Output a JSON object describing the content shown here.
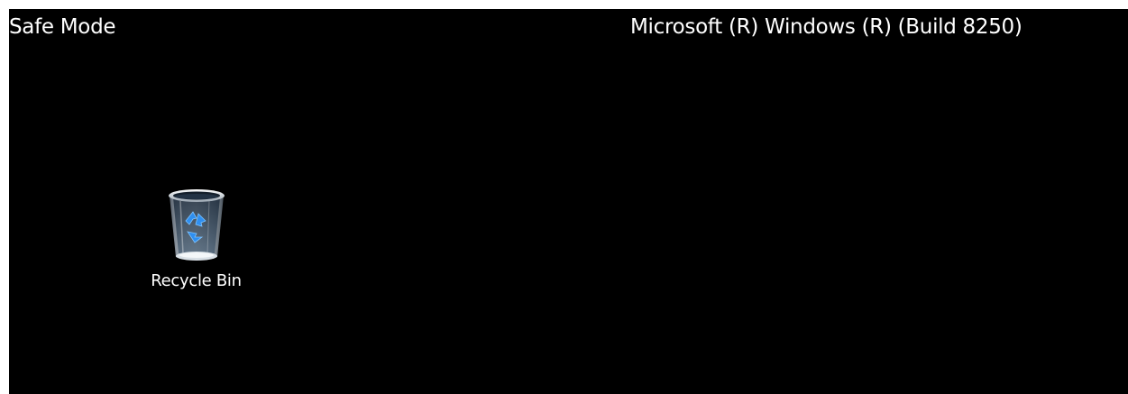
{
  "desktop": {
    "background_color": "#000000",
    "overlay_top_left": "Safe Mode",
    "overlay_top_right": "Microsoft (R) Windows (R) (Build 8250)",
    "icons": [
      {
        "label": "Recycle Bin",
        "icon": "recycle-bin-icon"
      }
    ]
  }
}
